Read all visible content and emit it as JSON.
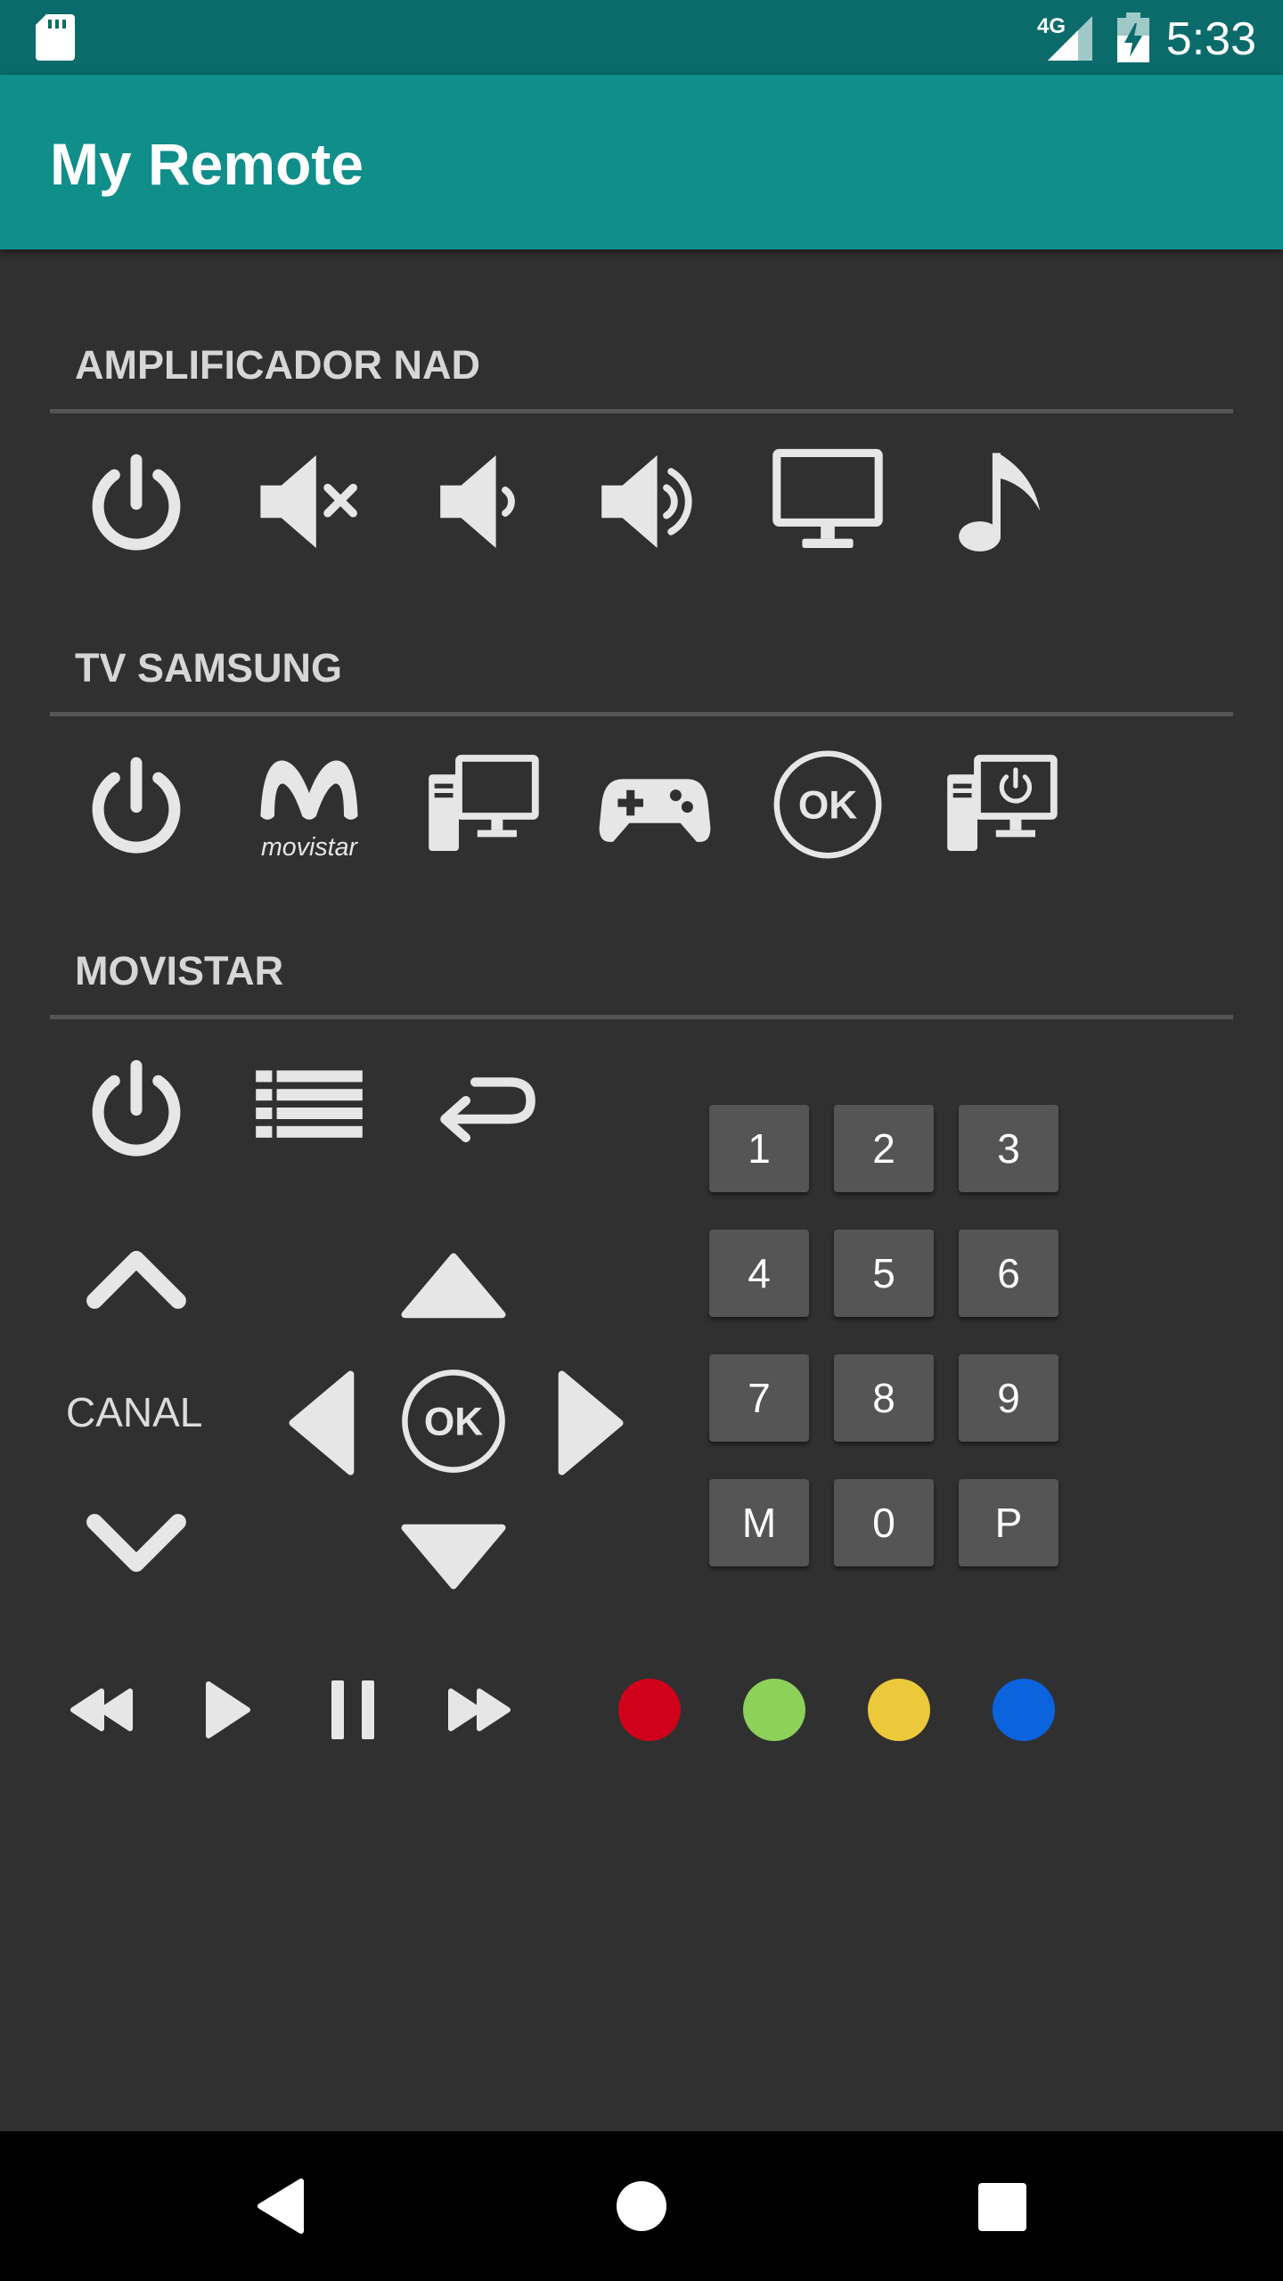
{
  "status_bar": {
    "time": "5:33",
    "network": "4G"
  },
  "app_bar": {
    "title": "My Remote"
  },
  "sections": {
    "amp": {
      "title": "AMPLIFICADOR NAD"
    },
    "tv": {
      "title": "TV SAMSUNG"
    },
    "movistar": {
      "title": "MOVISTAR"
    }
  },
  "movistar": {
    "canal_label": "CANAL",
    "ok_label": "OK",
    "keypad": [
      "1",
      "2",
      "3",
      "4",
      "5",
      "6",
      "7",
      "8",
      "9",
      "M",
      "0",
      "P"
    ]
  },
  "tv_ok_label": "OK",
  "movistar_logo_text": "movistar",
  "colors": {
    "primary": "#0f8e8a",
    "primary_dark": "#0b6b6b",
    "background": "#303030",
    "red": "#d0021b",
    "green": "#8dd05a",
    "yellow": "#ebc93a",
    "blue": "#0b63de"
  }
}
